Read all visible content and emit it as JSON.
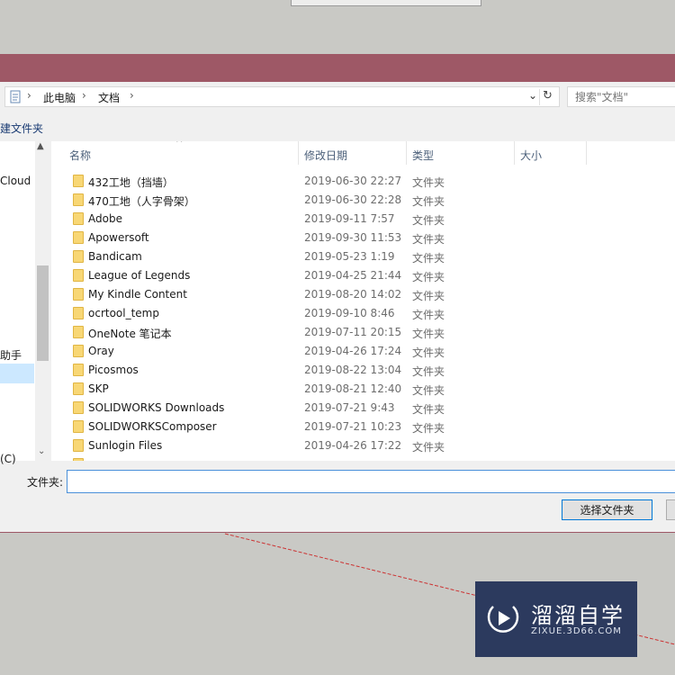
{
  "address_bar": {
    "crumbs": [
      "此电脑",
      "文档"
    ],
    "search_placeholder": "搜索\"文档\""
  },
  "toolbar": {
    "new_folder_label": "建文件夹"
  },
  "nav_pane": {
    "items": [
      " ",
      "Cloud F",
      "助手",
      "(C)"
    ]
  },
  "columns": {
    "name": "名称",
    "date": "修改日期",
    "type": "类型",
    "size": "大小"
  },
  "files": [
    {
      "name": "432工地（挡墙）",
      "date": "2019-06-30 22:27",
      "type": "文件夹"
    },
    {
      "name": "470工地（人字骨架）",
      "date": "2019-06-30 22:28",
      "type": "文件夹"
    },
    {
      "name": "Adobe",
      "date": "2019-09-11 7:57",
      "type": "文件夹"
    },
    {
      "name": "Apowersoft",
      "date": "2019-09-30 11:53",
      "type": "文件夹"
    },
    {
      "name": "Bandicam",
      "date": "2019-05-23 1:19",
      "type": "文件夹"
    },
    {
      "name": "League of Legends",
      "date": "2019-04-25 21:44",
      "type": "文件夹"
    },
    {
      "name": "My Kindle Content",
      "date": "2019-08-20 14:02",
      "type": "文件夹"
    },
    {
      "name": "ocrtool_temp",
      "date": "2019-09-10 8:46",
      "type": "文件夹"
    },
    {
      "name": "OneNote 笔记本",
      "date": "2019-07-11 20:15",
      "type": "文件夹"
    },
    {
      "name": "Oray",
      "date": "2019-04-26 17:24",
      "type": "文件夹"
    },
    {
      "name": "Picosmos",
      "date": "2019-08-22 13:04",
      "type": "文件夹"
    },
    {
      "name": "SKP",
      "date": "2019-08-21 12:40",
      "type": "文件夹"
    },
    {
      "name": "SOLIDWORKS Downloads",
      "date": "2019-07-21 9:43",
      "type": "文件夹"
    },
    {
      "name": "SOLIDWORKSComposer",
      "date": "2019-07-21 10:23",
      "type": "文件夹"
    },
    {
      "name": "Sunlogin Files",
      "date": "2019-04-26 17:22",
      "type": "文件夹"
    }
  ],
  "footer": {
    "folder_label": "文件夹:",
    "select_button": "选择文件夹"
  },
  "watermark": {
    "brand": "溜溜自学",
    "url": "ZIXUE.3D66.COM"
  },
  "colors": {
    "title_strip": "#9e5866",
    "folder": "#f8d775",
    "accent": "#0078d7"
  }
}
